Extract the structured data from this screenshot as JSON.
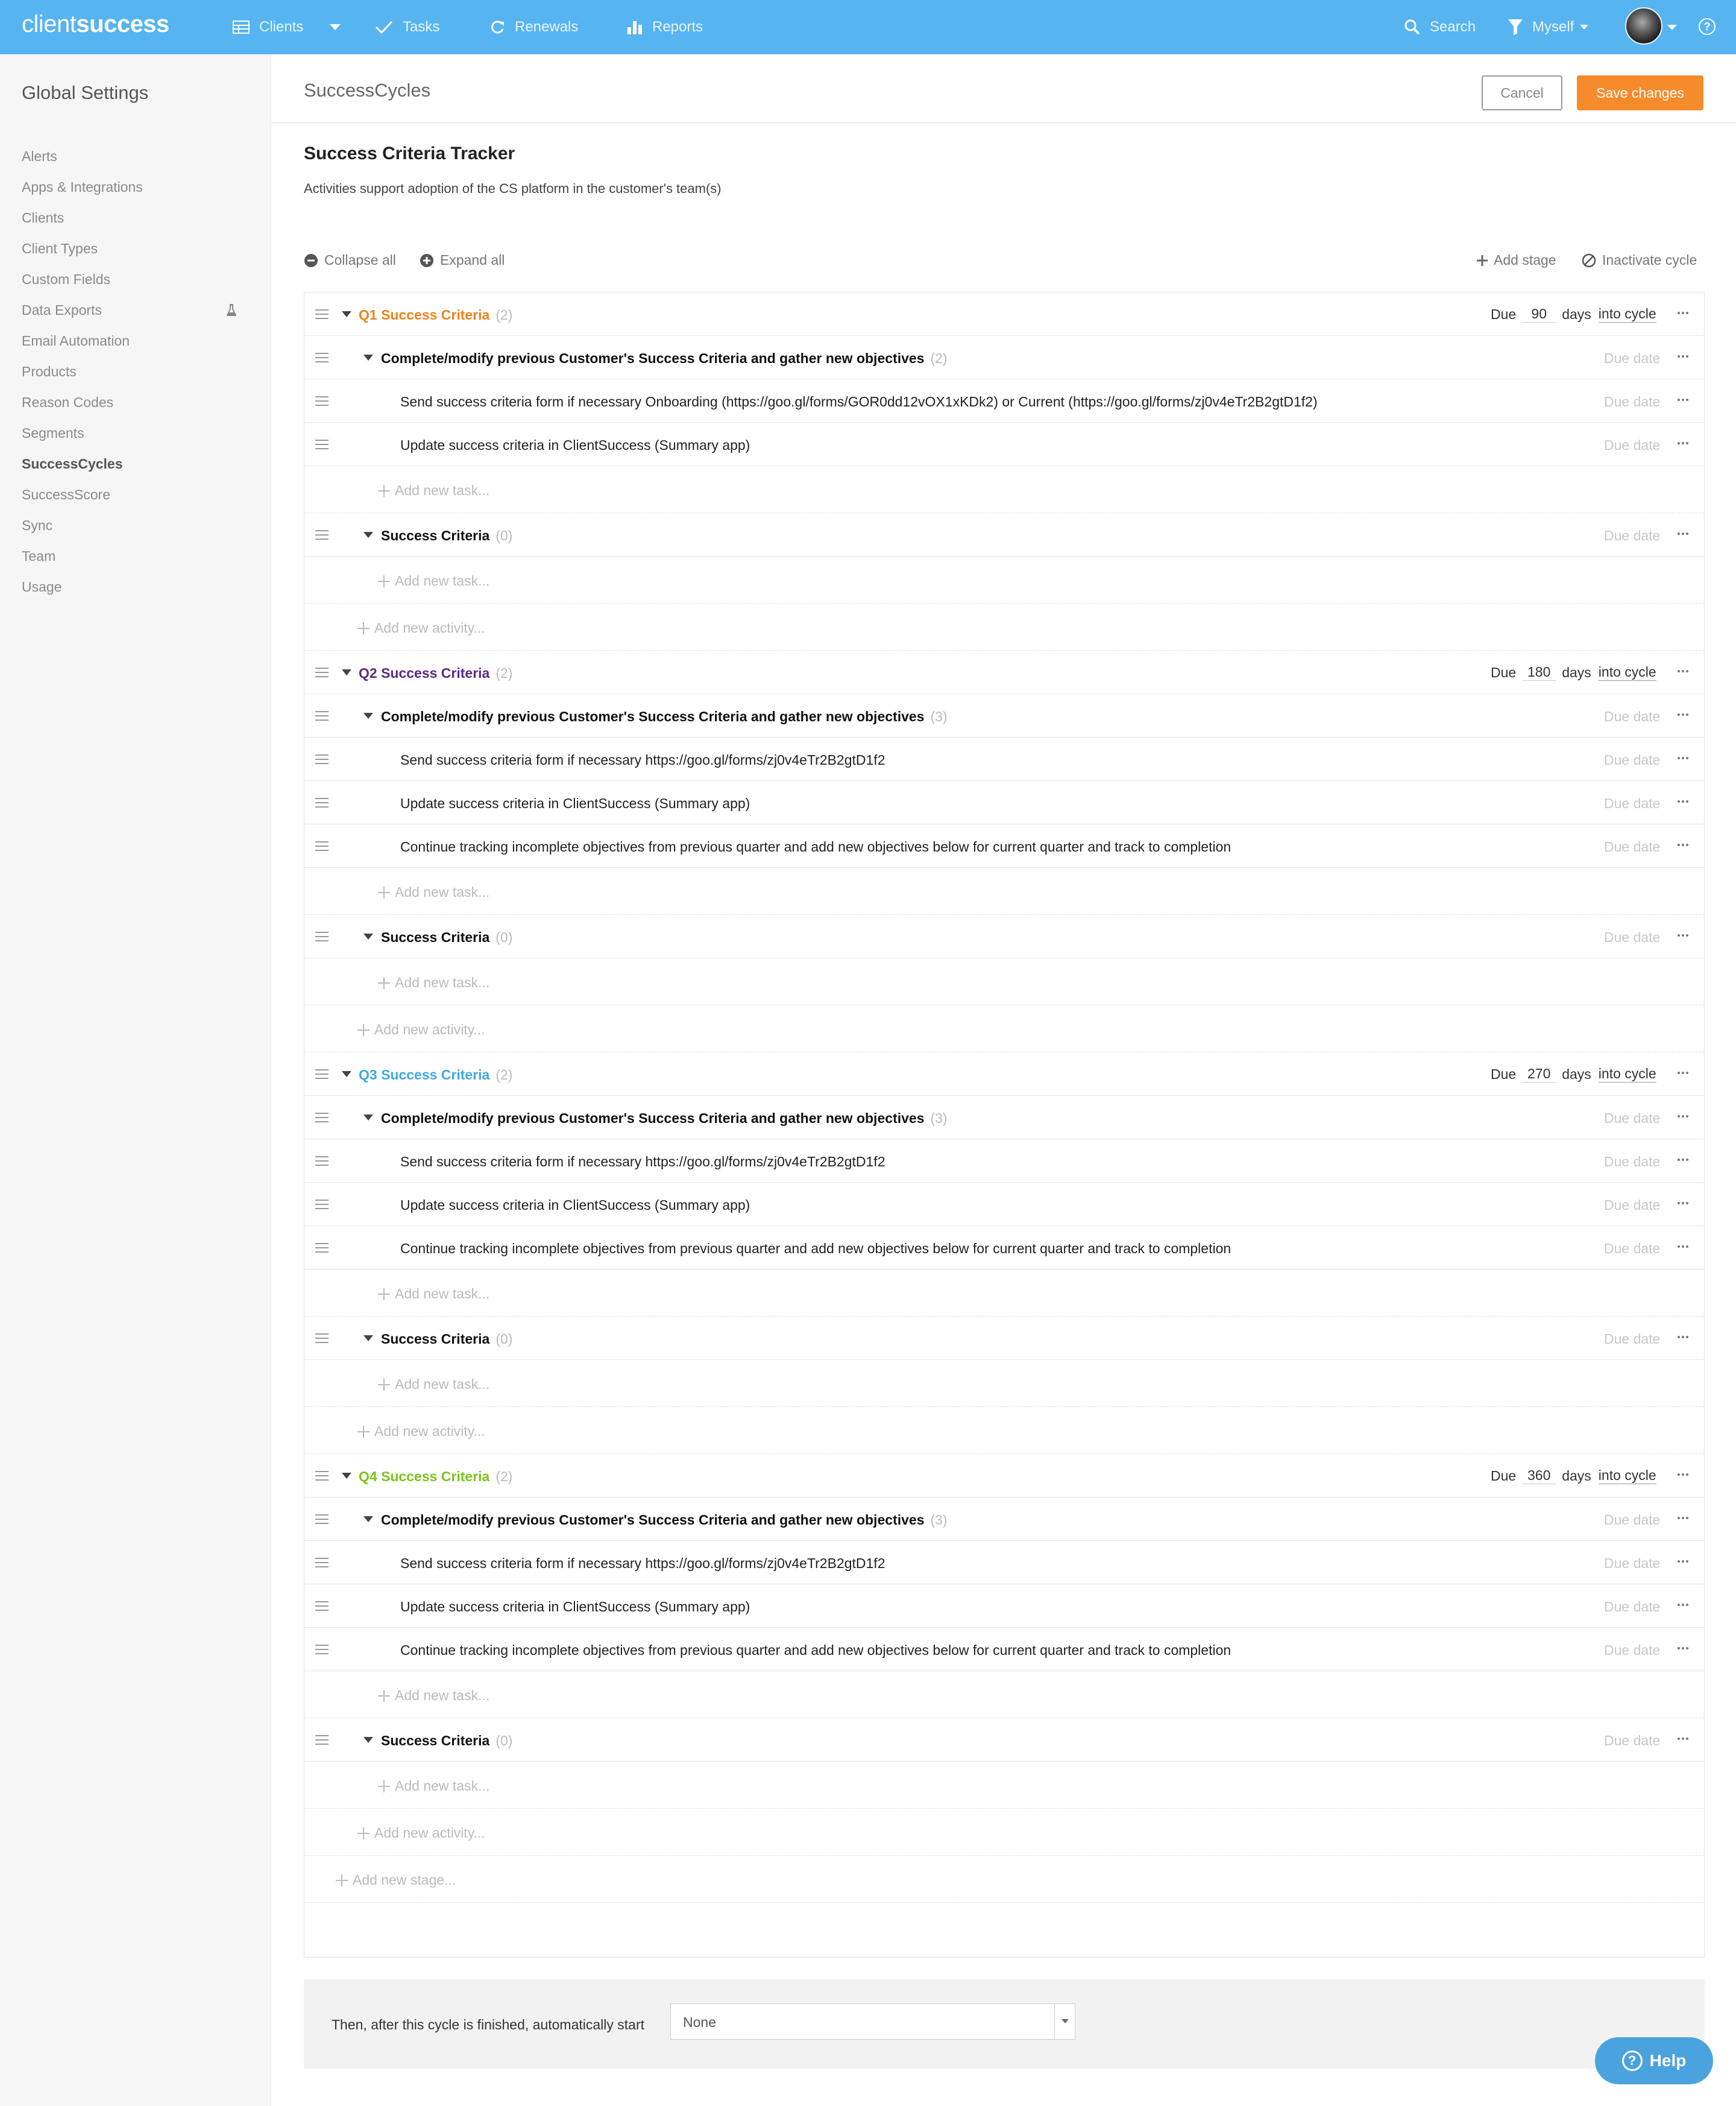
{
  "nav": {
    "logo_light": "client",
    "logo_bold": "success",
    "items": [
      "Clients",
      "Tasks",
      "Renewals",
      "Reports"
    ],
    "search": "Search",
    "filter": "Myself"
  },
  "sidebar": {
    "title": "Global Settings",
    "items": [
      "Alerts",
      "Apps & Integrations",
      "Clients",
      "Client Types",
      "Custom Fields",
      "Data Exports",
      "Email Automation",
      "Products",
      "Reason Codes",
      "Segments",
      "SuccessCycles",
      "SuccessScore",
      "Sync",
      "Team",
      "Usage"
    ],
    "active": "SuccessCycles"
  },
  "header": {
    "title": "SuccessCycles",
    "cancel": "Cancel",
    "save": "Save changes"
  },
  "tracker": {
    "title": "Success Criteria Tracker",
    "description": "Activities support adoption of the CS platform in the customer's team(s)",
    "collapse_all": "Collapse all",
    "expand_all": "Expand all",
    "add_stage": "Add stage",
    "inactivate": "Inactivate cycle"
  },
  "labels": {
    "due": "Due",
    "days": "days",
    "into_cycle": "into cycle",
    "due_date": "Due date",
    "add_task": "Add new task...",
    "add_activity": "Add new activity...",
    "add_stage": "Add new stage..."
  },
  "stages": [
    {
      "name": "Q1 Success Criteria",
      "count": "(2)",
      "days": "90",
      "color": "#f0821e",
      "activities": [
        {
          "name": "Complete/modify previous Customer's Success Criteria and gather new objectives",
          "count": "(2)",
          "tasks": [
            "Send success criteria form if necessary Onboarding (https://goo.gl/forms/GOR0dd12vOX1xKDk2) or Current (https://goo.gl/forms/zj0v4eTr2B2gtD1f2)",
            "Update success criteria in ClientSuccess (Summary app)"
          ]
        },
        {
          "name": "Success Criteria",
          "count": "(0)",
          "tasks": []
        }
      ]
    },
    {
      "name": "Q2 Success Criteria",
      "count": "(2)",
      "days": "180",
      "color": "#5b2a86",
      "activities": [
        {
          "name": "Complete/modify previous Customer's Success Criteria and gather new objectives",
          "count": "(3)",
          "tasks": [
            "Send success criteria form if necessary https://goo.gl/forms/zj0v4eTr2B2gtD1f2",
            "Update success criteria in ClientSuccess (Summary app)",
            "Continue tracking incomplete objectives from previous quarter and add new objectives below for current quarter and track to completion"
          ]
        },
        {
          "name": "Success Criteria",
          "count": "(0)",
          "tasks": []
        }
      ]
    },
    {
      "name": "Q3 Success Criteria",
      "count": "(2)",
      "days": "270",
      "color": "#3da9e8",
      "activities": [
        {
          "name": "Complete/modify previous Customer's Success Criteria and gather new objectives",
          "count": "(3)",
          "tasks": [
            "Send success criteria form if necessary https://goo.gl/forms/zj0v4eTr2B2gtD1f2",
            "Update success criteria in ClientSuccess (Summary app)",
            "Continue tracking incomplete objectives from previous quarter and add new objectives below for current quarter and track to completion"
          ]
        },
        {
          "name": "Success Criteria",
          "count": "(0)",
          "tasks": []
        }
      ]
    },
    {
      "name": "Q4 Success Criteria",
      "count": "(2)",
      "days": "360",
      "color": "#7dc41f",
      "activities": [
        {
          "name": "Complete/modify previous Customer's Success Criteria and gather new objectives",
          "count": "(3)",
          "tasks": [
            "Send success criteria form if necessary https://goo.gl/forms/zj0v4eTr2B2gtD1f2",
            "Update success criteria in ClientSuccess (Summary app)",
            "Continue tracking incomplete objectives from previous quarter and add new objectives below for current quarter and track to completion"
          ]
        },
        {
          "name": "Success Criteria",
          "count": "(0)",
          "tasks": []
        }
      ]
    }
  ],
  "footer": {
    "label": "Then, after this cycle is finished, automatically start",
    "select_value": "None"
  },
  "help": "Help",
  "colors": {
    "nav": "#56b4f1",
    "save": "#f68b2c",
    "help": "#4aa3df"
  }
}
